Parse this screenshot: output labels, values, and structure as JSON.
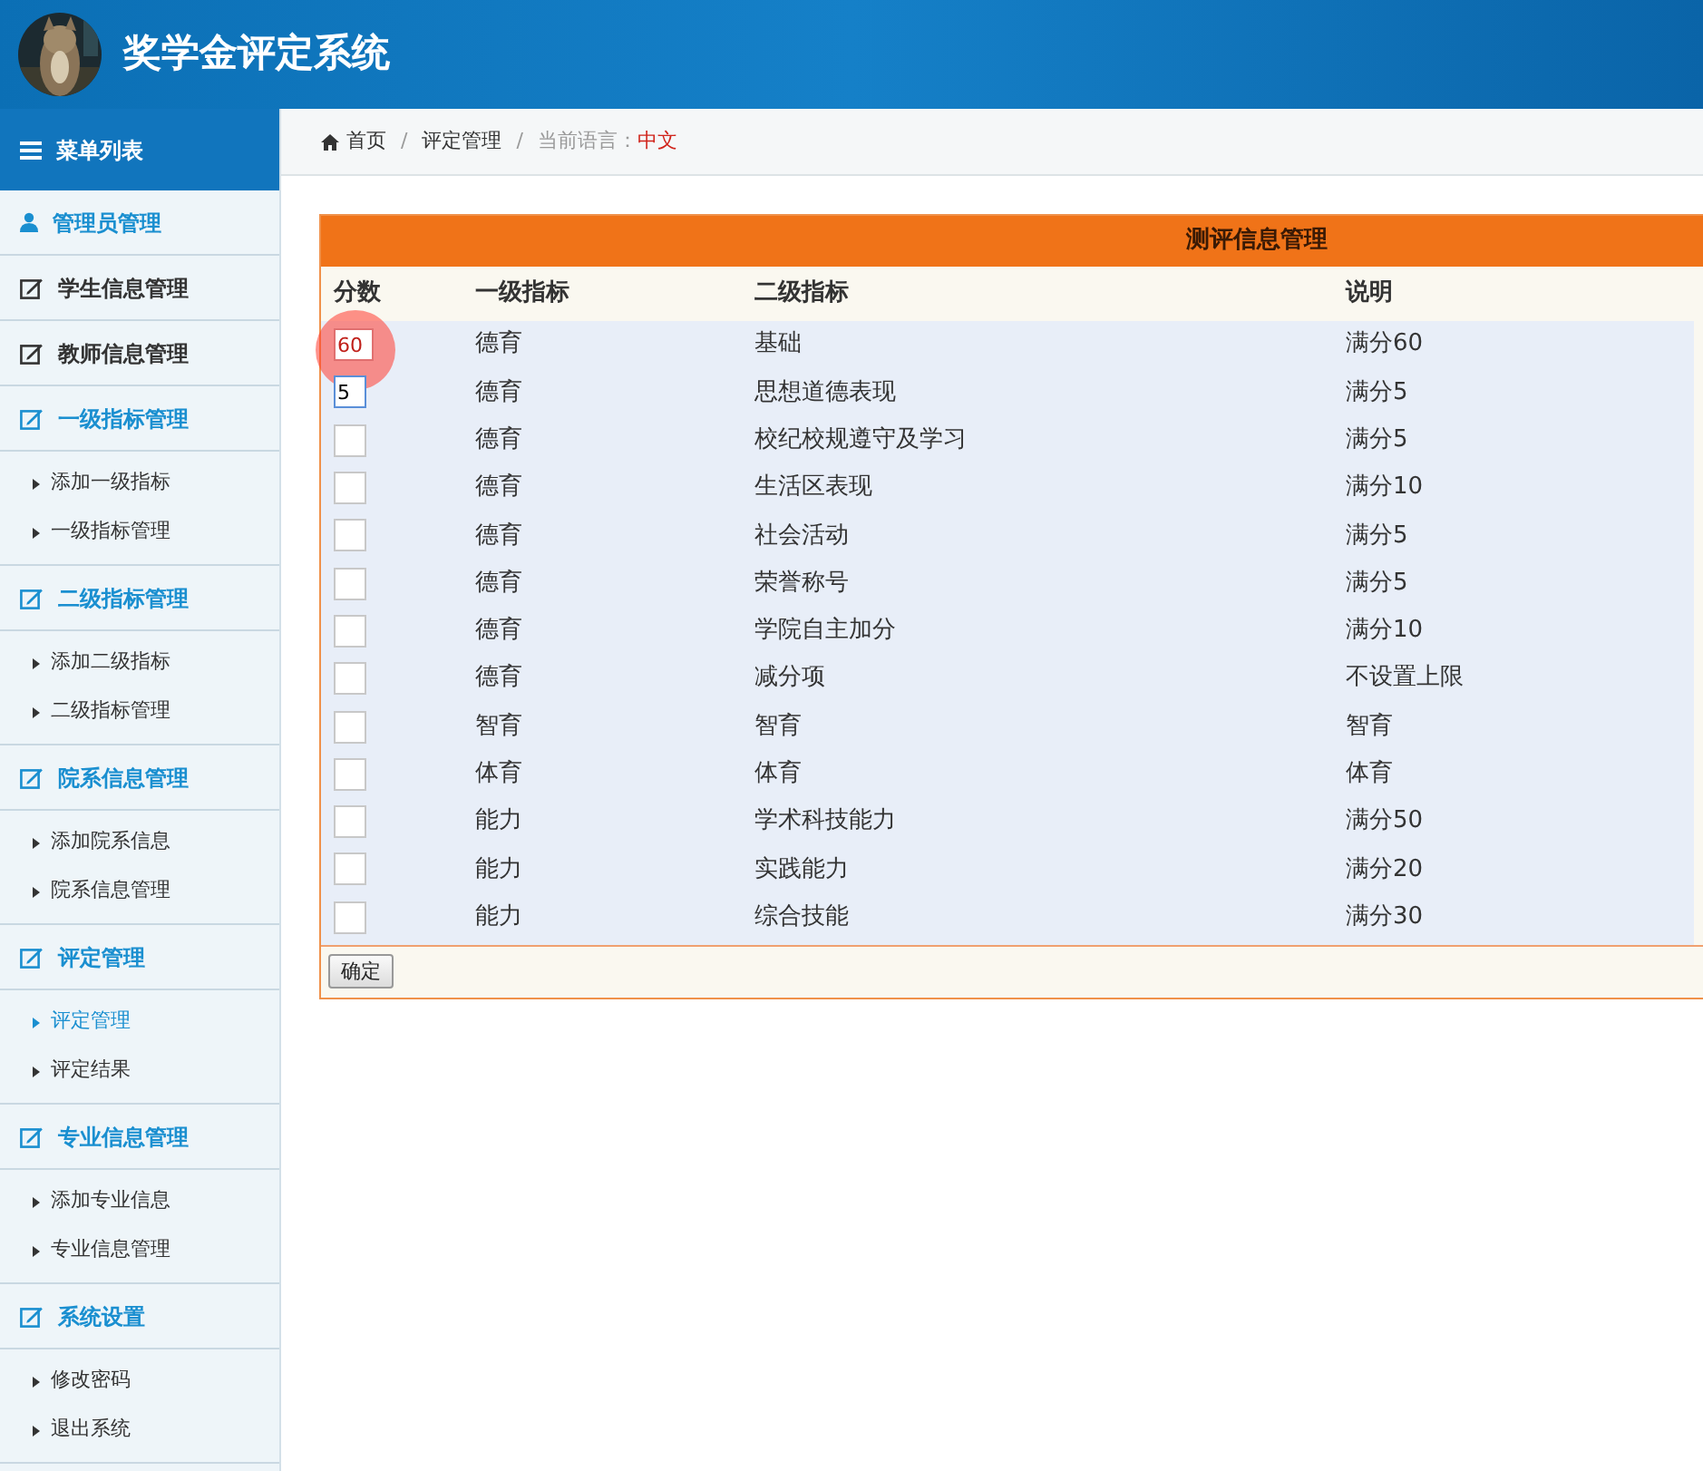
{
  "header": {
    "title": "奖学金评定系统"
  },
  "sidebar": {
    "title": "菜单列表",
    "items": [
      {
        "label": "管理员管理",
        "kind": "account",
        "highlighted": true
      },
      {
        "label": "学生信息管理",
        "kind": "module",
        "highlighted": false
      },
      {
        "label": "教师信息管理",
        "kind": "module",
        "highlighted": false
      },
      {
        "label": "一级指标管理",
        "kind": "module",
        "highlighted": true,
        "children": [
          {
            "label": "添加一级指标",
            "selected": false
          },
          {
            "label": "一级指标管理",
            "selected": false
          }
        ]
      },
      {
        "label": "二级指标管理",
        "kind": "module",
        "highlighted": true,
        "children": [
          {
            "label": "添加二级指标",
            "selected": false
          },
          {
            "label": "二级指标管理",
            "selected": false
          }
        ]
      },
      {
        "label": "院系信息管理",
        "kind": "module",
        "highlighted": true,
        "children": [
          {
            "label": "添加院系信息",
            "selected": false
          },
          {
            "label": "院系信息管理",
            "selected": false
          }
        ]
      },
      {
        "label": "评定管理",
        "kind": "module",
        "highlighted": true,
        "children": [
          {
            "label": "评定管理",
            "selected": true
          },
          {
            "label": "评定结果",
            "selected": false
          }
        ]
      },
      {
        "label": "专业信息管理",
        "kind": "module",
        "highlighted": true,
        "children": [
          {
            "label": "添加专业信息",
            "selected": false
          },
          {
            "label": "专业信息管理",
            "selected": false
          }
        ]
      },
      {
        "label": "系统设置",
        "kind": "module",
        "highlighted": true,
        "children": [
          {
            "label": "修改密码",
            "selected": false
          },
          {
            "label": "退出系统",
            "selected": false
          }
        ]
      }
    ]
  },
  "breadcrumb": {
    "items": [
      "首页",
      "评定管理"
    ],
    "separator": "/",
    "language_label": "当前语言：",
    "language": "中文"
  },
  "panel": {
    "title": "测评信息管理",
    "columns": [
      "分数",
      "一级指标",
      "二级指标",
      "说明"
    ],
    "rows": [
      {
        "score": "60",
        "focused": false,
        "clicked": true,
        "level1": "德育",
        "level2": "基础",
        "note": "满分60"
      },
      {
        "score": "5",
        "focused": true,
        "clicked": false,
        "level1": "德育",
        "level2": "思想道德表现",
        "note": "满分5"
      },
      {
        "focused": false,
        "clicked": false,
        "level1": "德育",
        "level2": "校纪校规遵守及学习",
        "note": "满分5"
      },
      {
        "focused": false,
        "clicked": false,
        "level1": "德育",
        "level2": "生活区表现",
        "note": "满分10"
      },
      {
        "focused": false,
        "clicked": false,
        "level1": "德育",
        "level2": "社会活动",
        "note": "满分5"
      },
      {
        "focused": false,
        "clicked": false,
        "level1": "德育",
        "level2": "荣誉称号",
        "note": "满分5"
      },
      {
        "focused": false,
        "clicked": false,
        "level1": "德育",
        "level2": "学院自主加分",
        "note": "满分10"
      },
      {
        "focused": false,
        "clicked": false,
        "level1": "德育",
        "level2": "减分项",
        "note": "不设置上限"
      },
      {
        "focused": false,
        "clicked": false,
        "level1": "智育",
        "level2": "智育",
        "note": "智育"
      },
      {
        "focused": false,
        "clicked": false,
        "level1": "体育",
        "level2": "体育",
        "note": "体育"
      },
      {
        "focused": false,
        "clicked": false,
        "level1": "能力",
        "level2": "学术科技能力",
        "note": "满分50"
      },
      {
        "focused": false,
        "clicked": false,
        "level1": "能力",
        "level2": "实践能力",
        "note": "满分20"
      },
      {
        "focused": false,
        "clicked": false,
        "level1": "能力",
        "level2": "综合技能",
        "note": "满分30"
      }
    ],
    "submit": "确定"
  }
}
